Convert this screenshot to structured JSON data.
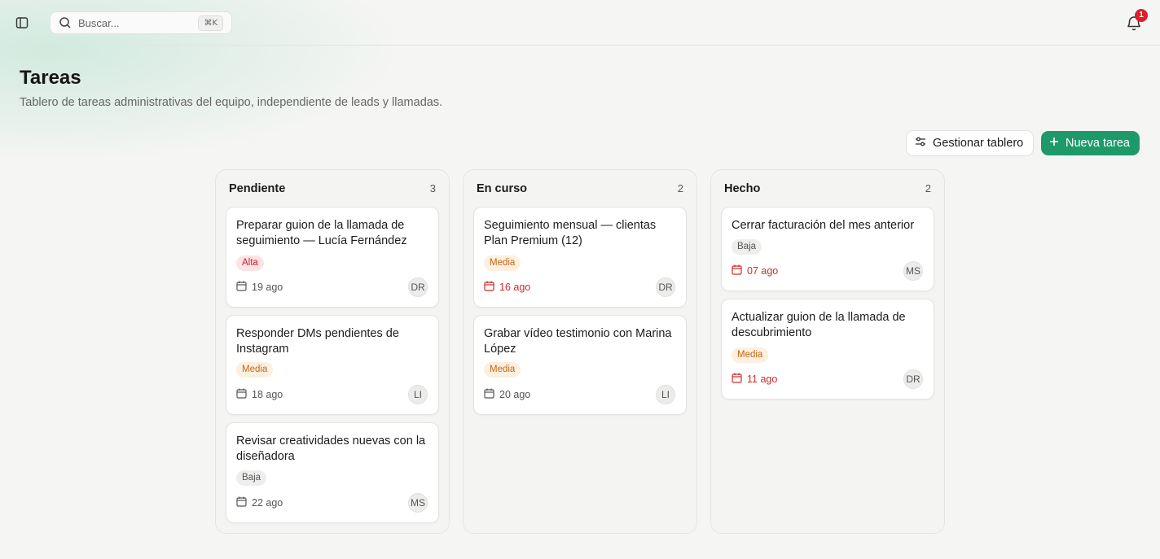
{
  "header": {
    "search_placeholder": "Buscar...",
    "search_shortcut": "⌘K",
    "notification_count": "1"
  },
  "page": {
    "title": "Tareas",
    "subtitle": "Tablero de tareas administrativas del equipo, independiente de leads y llamadas.",
    "manage_button": "Gestionar tablero",
    "new_button": "Nueva tarea"
  },
  "columns": [
    {
      "title": "Pendiente",
      "count": "3",
      "cards": [
        {
          "title": "Preparar guion de la llamada de seguimiento — Lucía Fernández",
          "priority": "Alta",
          "date": "19 ago",
          "assignee": "DR"
        },
        {
          "title": "Responder DMs pendientes de Instagram",
          "priority": "Media",
          "date": "18 ago",
          "assignee": "LI"
        },
        {
          "title": "Revisar creatividades nuevas con la diseñadora",
          "priority": "Baja",
          "date": "22 ago",
          "assignee": "MS"
        }
      ]
    },
    {
      "title": "En curso",
      "count": "2",
      "cards": [
        {
          "title": "Seguimiento mensual — clientas Plan Premium (12)",
          "priority": "Media",
          "date": "16 ago",
          "assignee": "DR",
          "overdue": true
        },
        {
          "title": "Grabar vídeo testimonio con Marina López",
          "priority": "Media",
          "date": "20 ago",
          "assignee": "LI"
        }
      ]
    },
    {
      "title": "Hecho",
      "count": "2",
      "cards": [
        {
          "title": "Cerrar facturación del mes anterior",
          "priority": "Baja",
          "date": "07 ago",
          "assignee": "MS",
          "overdue": true
        },
        {
          "title": "Actualizar guion de la llamada de descubrimiento",
          "priority": "Media",
          "date": "11 ago",
          "assignee": "DR",
          "overdue": true
        }
      ]
    }
  ],
  "colors": {
    "accent": "#1e9a6a",
    "overdue": "#d12a2a",
    "badge_alta": "#c5212b",
    "badge_media": "#c2661a"
  }
}
